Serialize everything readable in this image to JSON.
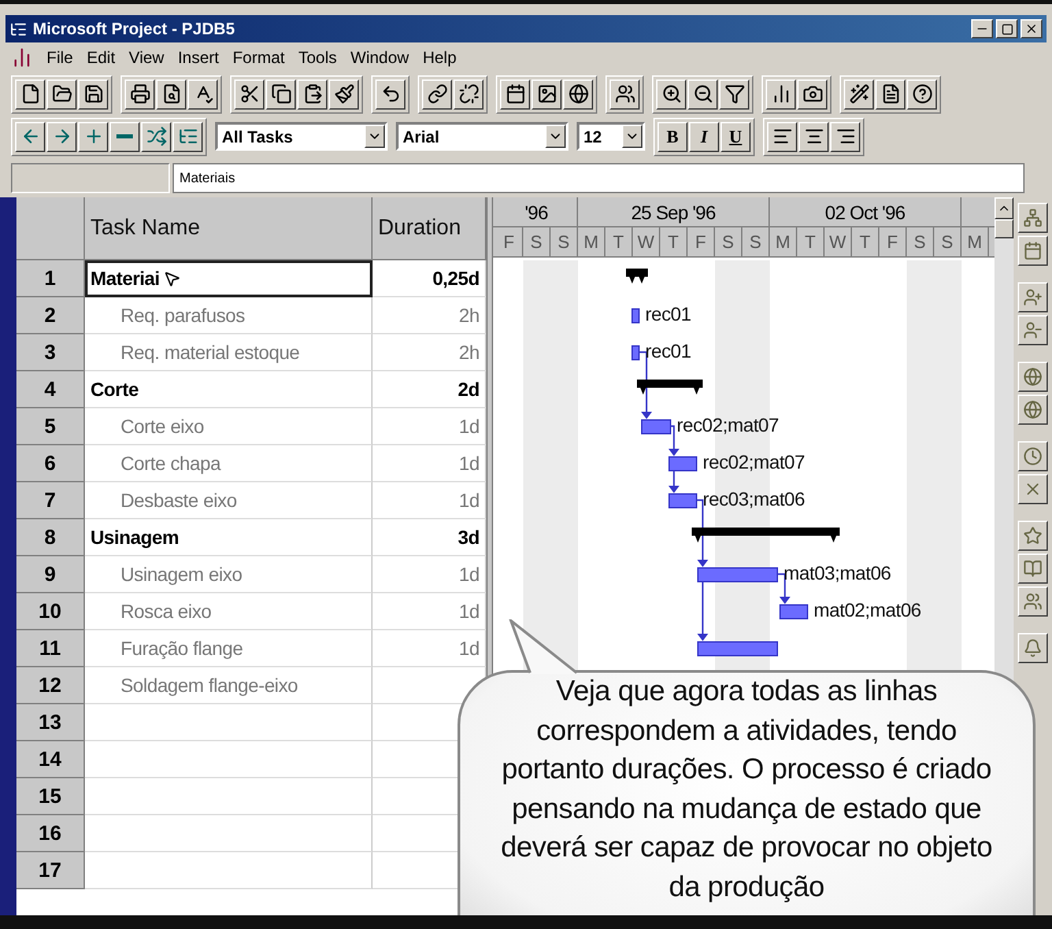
{
  "window": {
    "title": "Microsoft Project - PJDB5"
  },
  "menu": [
    "File",
    "Edit",
    "View",
    "Insert",
    "Format",
    "Tools",
    "Window",
    "Help"
  ],
  "format_bar": {
    "filter": "All Tasks",
    "font": "Arial",
    "size": "12",
    "bold": "B",
    "italic": "I",
    "underline": "U"
  },
  "entry_bar": {
    "value": "Materiais"
  },
  "table": {
    "columns": [
      "Task Name",
      "Duration"
    ],
    "rows": [
      {
        "id": "1",
        "name": "Materiai",
        "duration": "0,25d",
        "kind": "summary",
        "selected": true
      },
      {
        "id": "2",
        "name": "Req. parafusos",
        "duration": "2h",
        "kind": "task",
        "selected": false
      },
      {
        "id": "3",
        "name": "Req. material estoque",
        "duration": "2h",
        "kind": "task",
        "selected": false
      },
      {
        "id": "4",
        "name": "Corte",
        "duration": "2d",
        "kind": "summary",
        "selected": false
      },
      {
        "id": "5",
        "name": "Corte eixo",
        "duration": "1d",
        "kind": "task",
        "selected": false
      },
      {
        "id": "6",
        "name": "Corte chapa",
        "duration": "1d",
        "kind": "task",
        "selected": false
      },
      {
        "id": "7",
        "name": "Desbaste eixo",
        "duration": "1d",
        "kind": "task",
        "selected": false
      },
      {
        "id": "8",
        "name": "Usinagem",
        "duration": "3d",
        "kind": "summary",
        "selected": false
      },
      {
        "id": "9",
        "name": "Usinagem eixo",
        "duration": "1d",
        "kind": "task",
        "selected": false
      },
      {
        "id": "10",
        "name": "Rosca eixo",
        "duration": "1d",
        "kind": "task",
        "selected": false
      },
      {
        "id": "11",
        "name": "Furação flange",
        "duration": "1d",
        "kind": "task",
        "selected": false
      },
      {
        "id": "12",
        "name": "Soldagem flange-eixo",
        "kind": "task",
        "selected": false
      },
      {
        "id": "13",
        "kind": "empty",
        "selected": false
      },
      {
        "id": "14",
        "kind": "empty",
        "selected": false
      },
      {
        "id": "15",
        "kind": "empty",
        "selected": false
      },
      {
        "id": "16",
        "kind": "empty",
        "selected": false
      },
      {
        "id": "17",
        "kind": "empty",
        "selected": false
      }
    ]
  },
  "gantt": {
    "timescale_major": [
      "'96",
      "25 Sep '96",
      "02 Oct '96"
    ],
    "timescale_minor": [
      "F",
      "S",
      "S",
      "M",
      "T",
      "W",
      "T",
      "F",
      "S",
      "S",
      "M",
      "T",
      "W",
      "T",
      "F",
      "S",
      "S",
      "M"
    ],
    "bars": [
      {
        "kind": "summary"
      },
      {
        "kind": "task",
        "label": "rec01"
      },
      {
        "kind": "task",
        "label": "rec01"
      },
      {
        "kind": "summary"
      },
      {
        "kind": "task",
        "label": "rec02;mat07"
      },
      {
        "kind": "task",
        "label": "rec02;mat07"
      },
      {
        "kind": "task",
        "label": "rec03;mat06"
      },
      {
        "kind": "summary"
      },
      {
        "kind": "task",
        "label": "mat03;mat06"
      },
      {
        "kind": "task",
        "label": "mat02;mat06"
      },
      {
        "kind": "task"
      }
    ]
  },
  "callout": {
    "text": "Veja que agora todas as linhas\ncorrespondem a atividades, tendo\nportanto durações. O processo é criado\npensando na mudança de estado que\ndeverá ser capaz de provocar no objeto\nda produção"
  }
}
